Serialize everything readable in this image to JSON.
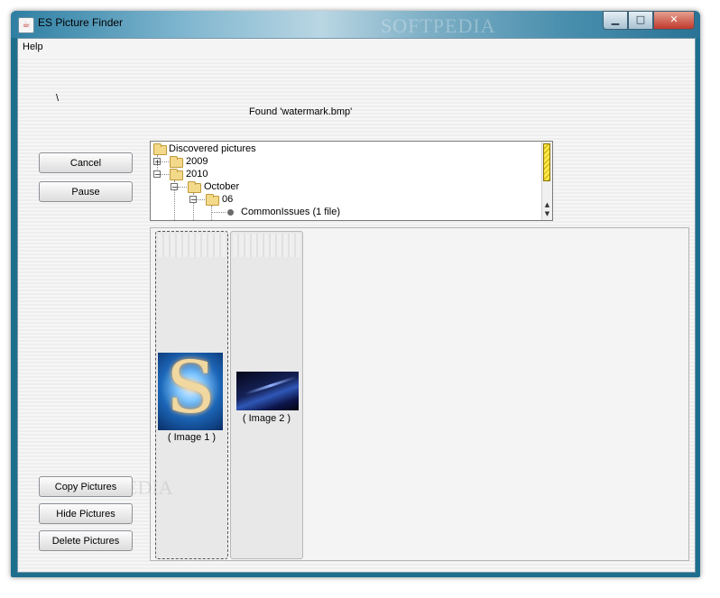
{
  "window": {
    "title": "ES Picture Finder",
    "watermark": "SOFTPEDIA"
  },
  "menu": {
    "help": "Help"
  },
  "status": {
    "path": "\\",
    "message": "Found 'watermark.bmp'"
  },
  "buttons": {
    "cancel": "Cancel",
    "pause": "Pause",
    "copy": "Copy Pictures",
    "hide": "Hide Pictures",
    "delete": "Delete Pictures"
  },
  "tree": {
    "root": "Discovered pictures",
    "y2009": "2009",
    "y2010": "2010",
    "month": "October",
    "day": "06",
    "leaf": "CommonIssues (1 file)"
  },
  "gallery": {
    "items": [
      {
        "caption": "( Image 1 )"
      },
      {
        "caption": "( Image 2 )"
      }
    ]
  },
  "icons": {
    "app": "java-cup-icon",
    "minimize": "minimize-icon",
    "maximize": "maximize-icon",
    "close": "close-icon",
    "folder": "folder-icon",
    "leaf": "bullet-icon"
  }
}
